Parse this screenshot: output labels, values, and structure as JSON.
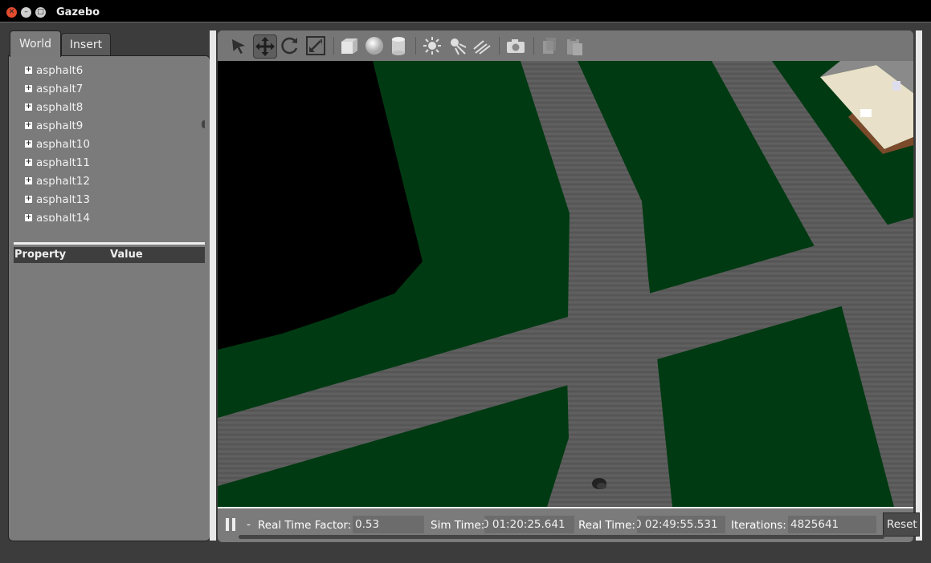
{
  "window": {
    "title": "Gazebo",
    "close": "✕",
    "minimize": "–",
    "maximize": "□"
  },
  "left_panel": {
    "tabs": [
      "World",
      "Insert"
    ],
    "tree_items": [
      "asphalt6",
      "asphalt7",
      "asphalt8",
      "asphalt9",
      "asphalt10",
      "asphalt11",
      "asphalt12",
      "asphalt13",
      "asphalt14"
    ],
    "property_header": {
      "property": "Property",
      "value": "Value"
    }
  },
  "toolbar": {
    "tools": [
      "select-arrow-icon",
      "translate-icon",
      "rotate-icon",
      "scale-icon",
      "box-icon",
      "sphere-icon",
      "cylinder-icon",
      "point-light-icon",
      "spot-light-icon",
      "directional-light-icon",
      "screenshot-icon",
      "copy-icon",
      "paste-icon"
    ],
    "active_tool": "translate-icon"
  },
  "status": {
    "step_indicator": "-",
    "real_time_factor_label": "Real Time Factor:",
    "real_time_factor": "0.53",
    "sim_time_label": "Sim Time:",
    "sim_time": "0 01:20:25.641",
    "real_time_label": "Real Time:",
    "real_time": "0 02:49:55.531",
    "iterations_label": "Iterations:",
    "iterations": "4825641",
    "reset_label": "Reset"
  },
  "colors": {
    "grass": "#003a12",
    "asphalt": "#5a5a5a",
    "building": "#000000",
    "panel": "#7b7b7b"
  }
}
